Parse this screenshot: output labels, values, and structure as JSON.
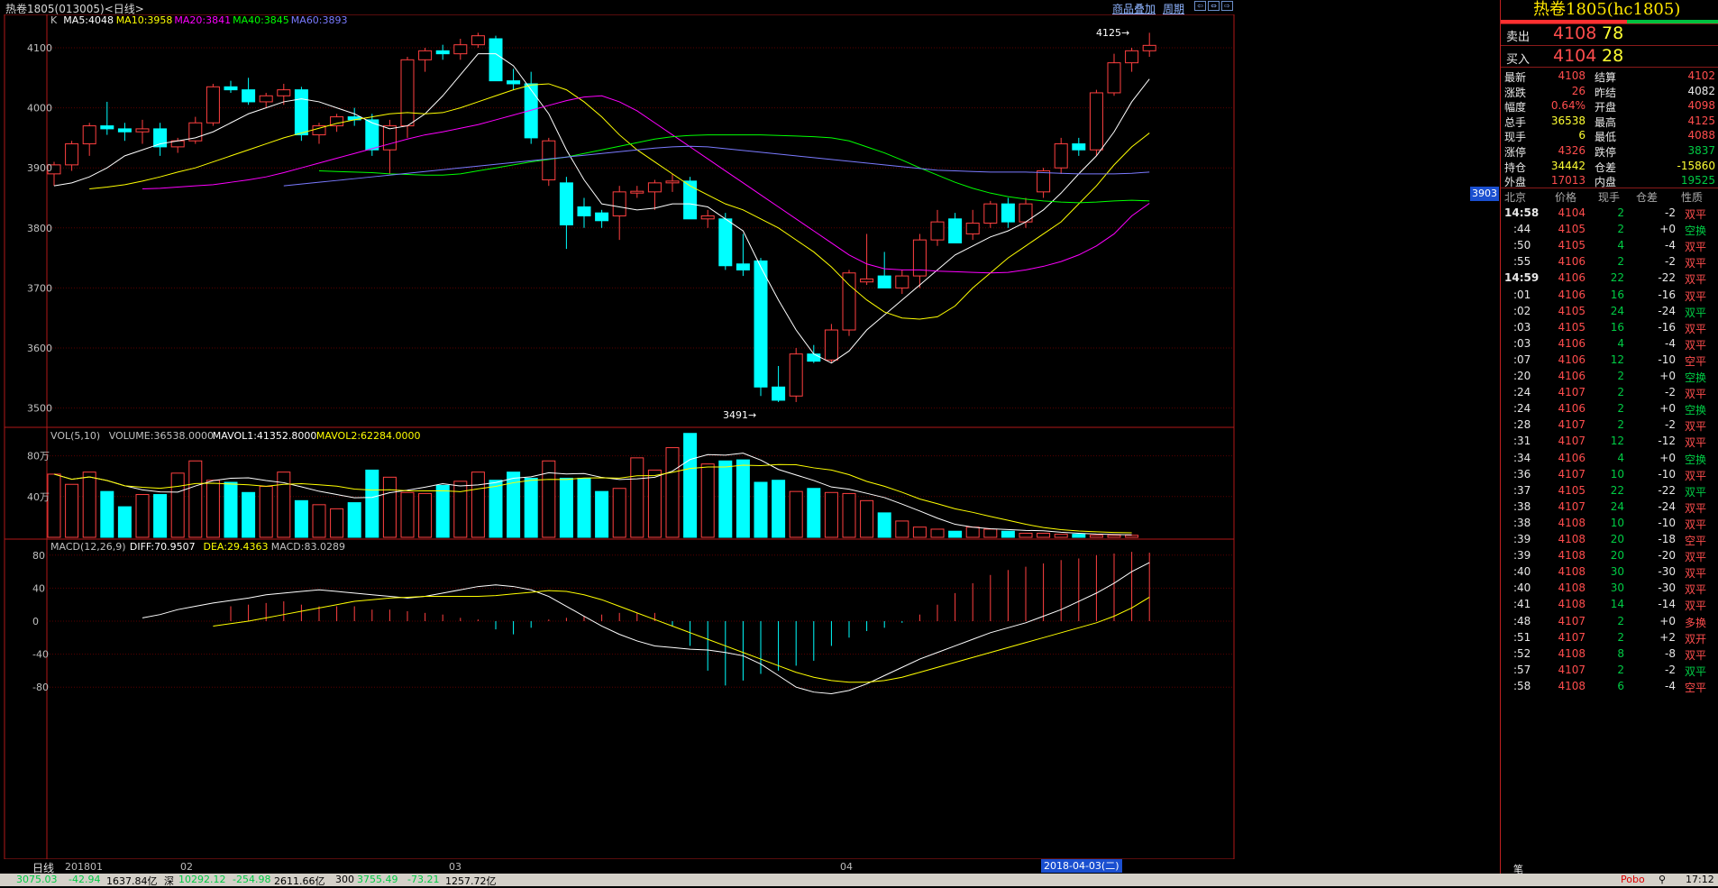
{
  "topbar": {
    "title": "热卷1805(013005)<日线>",
    "link_overlay": "商品叠加",
    "link_period": "周期"
  },
  "kpanel": {
    "label": "K",
    "ma5": "MA5:4048",
    "ma10": "MA10:3958",
    "ma20": "MA20:3841",
    "ma40": "MA40:3845",
    "ma60": "MA60:3893",
    "high_note": "4125",
    "low_note": "3491",
    "price_tag": "3903",
    "yticks": [
      "4100",
      "4000",
      "3900",
      "3800",
      "3700",
      "3600",
      "3500"
    ]
  },
  "vpanel": {
    "label": "VOL(5,10)",
    "volume": "VOLUME:36538.0000",
    "mavol1": "MAVOL1:41352.8000",
    "mavol2": "MAVOL2:62284.0000",
    "yticks": [
      "80万",
      "40万"
    ]
  },
  "mpanel": {
    "label": "MACD(12,26,9)",
    "diff": "DIFF:70.9507",
    "dea": "DEA:29.4363",
    "macd": "MACD:83.0289",
    "yticks": [
      "80",
      "40",
      "0",
      "-40",
      "-80"
    ]
  },
  "xaxis": {
    "tab": "日线",
    "labels": [
      "201801",
      "02",
      "03",
      "04"
    ],
    "selected_date": "2018-04-03(二)"
  },
  "colors": {
    "up": "#ff4040",
    "down": "#00ffff",
    "ma5": "#ffffff",
    "ma10": "#ffff00",
    "ma20": "#ff00ff",
    "ma40": "#00ff00",
    "ma60": "#7a7aff",
    "grid": "#5a0000"
  },
  "chart_data": {
    "type": "candlestick",
    "candles": [
      [
        3890,
        3910,
        3870,
        3905
      ],
      [
        3905,
        3945,
        3895,
        3940
      ],
      [
        3940,
        3975,
        3920,
        3970
      ],
      [
        3970,
        4010,
        3955,
        3965
      ],
      [
        3965,
        3975,
        3945,
        3960
      ],
      [
        3960,
        3980,
        3940,
        3965
      ],
      [
        3965,
        3975,
        3920,
        3935
      ],
      [
        3935,
        3950,
        3925,
        3945
      ],
      [
        3945,
        3985,
        3940,
        3975
      ],
      [
        3975,
        4040,
        3970,
        4035
      ],
      [
        4035,
        4045,
        4025,
        4030
      ],
      [
        4030,
        4050,
        4005,
        4010
      ],
      [
        4010,
        4025,
        4000,
        4020
      ],
      [
        4020,
        4040,
        4005,
        4030
      ],
      [
        4030,
        4035,
        3945,
        3955
      ],
      [
        3955,
        3975,
        3940,
        3970
      ],
      [
        3970,
        3990,
        3960,
        3985
      ],
      [
        3985,
        4000,
        3970,
        3980
      ],
      [
        3980,
        3990,
        3920,
        3930
      ],
      [
        3930,
        3980,
        3890,
        3970
      ],
      [
        3970,
        4085,
        3950,
        4080
      ],
      [
        4080,
        4100,
        4060,
        4095
      ],
      [
        4095,
        4105,
        4080,
        4090
      ],
      [
        4090,
        4115,
        4080,
        4105
      ],
      [
        4105,
        4125,
        4100,
        4120
      ],
      [
        4115,
        4120,
        4045,
        4045
      ],
      [
        4045,
        4065,
        4030,
        4040
      ],
      [
        4040,
        4060,
        3940,
        3950
      ],
      [
        3880,
        3950,
        3870,
        3945
      ],
      [
        3875,
        3885,
        3765,
        3805
      ],
      [
        3835,
        3850,
        3800,
        3820
      ],
      [
        3825,
        3830,
        3800,
        3812
      ],
      [
        3820,
        3870,
        3780,
        3860
      ],
      [
        3858,
        3870,
        3850,
        3861
      ],
      [
        3860,
        3880,
        3830,
        3875
      ],
      [
        3875,
        3890,
        3860,
        3878
      ],
      [
        3878,
        3885,
        3815,
        3815
      ],
      [
        3815,
        3830,
        3800,
        3820
      ],
      [
        3815,
        3825,
        3730,
        3737
      ],
      [
        3740,
        3790,
        3720,
        3730
      ],
      [
        3745,
        3750,
        3520,
        3535
      ],
      [
        3535,
        3570,
        3510,
        3513
      ],
      [
        3520,
        3600,
        3510,
        3590
      ],
      [
        3590,
        3605,
        3575,
        3578
      ],
      [
        3580,
        3640,
        3575,
        3630
      ],
      [
        3630,
        3730,
        3620,
        3725
      ],
      [
        3710,
        3790,
        3705,
        3715
      ],
      [
        3720,
        3760,
        3700,
        3700
      ],
      [
        3700,
        3730,
        3690,
        3720
      ],
      [
        3720,
        3790,
        3700,
        3780
      ],
      [
        3780,
        3830,
        3770,
        3810
      ],
      [
        3815,
        3825,
        3775,
        3775
      ],
      [
        3790,
        3830,
        3780,
        3808
      ],
      [
        3808,
        3845,
        3800,
        3840
      ],
      [
        3840,
        3850,
        3800,
        3810
      ],
      [
        3810,
        3850,
        3800,
        3840
      ],
      [
        3860,
        3900,
        3850,
        3895
      ],
      [
        3900,
        3950,
        3890,
        3940
      ],
      [
        3940,
        3950,
        3920,
        3930
      ],
      [
        3930,
        4030,
        3920,
        4025
      ],
      [
        4025,
        4090,
        4020,
        4075
      ],
      [
        4075,
        4100,
        4060,
        4095
      ],
      [
        4095,
        4125,
        4085,
        4104
      ]
    ],
    "ma5": [
      3870,
      3875,
      3885,
      3900,
      3920,
      3930,
      3940,
      3945,
      3950,
      3960,
      3975,
      3990,
      4000,
      4010,
      4015,
      4010,
      4000,
      3990,
      3975,
      3965,
      3970,
      3990,
      4020,
      4055,
      4090,
      4090,
      4070,
      4030,
      3990,
      3930,
      3880,
      3840,
      3835,
      3830,
      3833,
      3840,
      3840,
      3835,
      3815,
      3795,
      3735,
      3680,
      3630,
      3590,
      3575,
      3595,
      3630,
      3655,
      3680,
      3705,
      3730,
      3755,
      3770,
      3785,
      3795,
      3810,
      3830,
      3858,
      3890,
      3920,
      3960,
      4010,
      4048
    ],
    "ma10": [
      3865,
      3868,
      3872,
      3878,
      3885,
      3893,
      3900,
      3910,
      3920,
      3930,
      3940,
      3950,
      3958,
      3966,
      3974,
      3980,
      3985,
      3990,
      3992,
      3990,
      3992,
      4000,
      4010,
      4020,
      4030,
      4038,
      4040,
      4030,
      4010,
      3985,
      3955,
      3930,
      3910,
      3890,
      3870,
      3855,
      3840,
      3830,
      3815,
      3800,
      3780,
      3760,
      3735,
      3705,
      3680,
      3660,
      3650,
      3648,
      3652,
      3670,
      3700,
      3725,
      3750,
      3770,
      3790,
      3810,
      3840,
      3870,
      3905,
      3935,
      3958
    ],
    "ma20": [
      3865,
      3866,
      3868,
      3870,
      3872,
      3876,
      3880,
      3885,
      3892,
      3900,
      3908,
      3916,
      3924,
      3932,
      3940,
      3948,
      3955,
      3960,
      3966,
      3972,
      3980,
      3988,
      3996,
      4004,
      4012,
      4018,
      4020,
      4010,
      3995,
      3975,
      3955,
      3935,
      3915,
      3895,
      3875,
      3855,
      3835,
      3815,
      3795,
      3775,
      3755,
      3740,
      3732,
      3730,
      3730,
      3728,
      3727,
      3726,
      3725,
      3726,
      3730,
      3736,
      3744,
      3755,
      3770,
      3790,
      3820,
      3841
    ],
    "ma40": [
      3895,
      3894,
      3893,
      3892,
      3890,
      3889,
      3888,
      3888,
      3890,
      3895,
      3900,
      3905,
      3910,
      3914,
      3918,
      3924,
      3930,
      3936,
      3942,
      3948,
      3952,
      3954,
      3955,
      3955,
      3955,
      3955,
      3954,
      3953,
      3952,
      3950,
      3945,
      3935,
      3925,
      3913,
      3900,
      3888,
      3876,
      3866,
      3858,
      3852,
      3848,
      3845,
      3843,
      3842,
      3843,
      3845,
      3846,
      3845
    ],
    "ma60": [
      3870,
      3873,
      3876,
      3879,
      3882,
      3885,
      3888,
      3891,
      3894,
      3897,
      3900,
      3903,
      3906,
      3909,
      3912,
      3915,
      3918,
      3921,
      3924,
      3927,
      3930,
      3933,
      3935,
      3936,
      3935,
      3932,
      3929,
      3926,
      3923,
      3920,
      3917,
      3914,
      3911,
      3908,
      3905,
      3902,
      3899,
      3896,
      3895,
      3894,
      3893,
      3893,
      3893,
      3892,
      3891,
      3890,
      3890,
      3890,
      3891,
      3893
    ],
    "volume": [
      620000,
      520000,
      640000,
      450000,
      300000,
      420000,
      420000,
      630000,
      750000,
      560000,
      540000,
      440000,
      500000,
      640000,
      360000,
      320000,
      280000,
      340000,
      660000,
      590000,
      440000,
      430000,
      510000,
      550000,
      640000,
      560000,
      640000,
      580000,
      750000,
      580000,
      580000,
      450000,
      480000,
      780000,
      660000,
      880000,
      1020000,
      720000,
      750000,
      760000,
      540000,
      560000,
      450000,
      480000,
      440000,
      430000,
      360000,
      240000,
      160000,
      100000,
      80000,
      60000,
      100000,
      80000,
      60000,
      40000,
      40000,
      30000,
      30000,
      20000,
      20000,
      20000
    ],
    "macd_diff": [
      4,
      8,
      14,
      18,
      22,
      25,
      28,
      32,
      34,
      36,
      38,
      36,
      34,
      32,
      30,
      28,
      30,
      34,
      38,
      42,
      44,
      42,
      38,
      30,
      18,
      6,
      -6,
      -16,
      -24,
      -30,
      -32,
      -34,
      -35,
      -38,
      -42,
      -52,
      -66,
      -80,
      -86,
      -88,
      -84,
      -76,
      -66,
      -56,
      -46,
      -38,
      -30,
      -22,
      -14,
      -8,
      -2,
      6,
      14,
      24,
      34,
      46,
      60,
      71
    ],
    "macd_dea": [
      -6,
      -3,
      0,
      4,
      8,
      12,
      16,
      20,
      24,
      26,
      28,
      29,
      30,
      30,
      30,
      30,
      31,
      33,
      35,
      37,
      36,
      32,
      26,
      18,
      10,
      2,
      -6,
      -14,
      -22,
      -30,
      -38,
      -46,
      -54,
      -62,
      -68,
      -72,
      -74,
      -74,
      -72,
      -68,
      -62,
      -56,
      -50,
      -44,
      -38,
      -32,
      -26,
      -20,
      -14,
      -8,
      -2,
      6,
      16,
      29
    ],
    "macd_hist": [
      18,
      20,
      22,
      24,
      20,
      18,
      18,
      18,
      14,
      14,
      12,
      10,
      8,
      4,
      2,
      -10,
      -16,
      -8,
      2,
      4,
      6,
      8,
      10,
      10,
      10,
      -6,
      -30,
      -60,
      -78,
      -72,
      -64,
      -60,
      -54,
      -48,
      -30,
      -20,
      -12,
      -8,
      -2,
      8,
      20,
      34,
      46,
      56,
      62,
      66,
      70,
      74,
      76,
      80,
      82,
      84,
      83
    ]
  },
  "panel": {
    "title": "热卷1805(hc1805)",
    "sell_label": "卖出",
    "sell_price": "4108",
    "sell_qty": "78",
    "buy_label": "买入",
    "buy_price": "4104",
    "buy_qty": "28",
    "quotes": [
      {
        "l": "最新",
        "v": "4108",
        "vc": "up",
        "l2": "结算",
        "v2": "4102",
        "v2c": "up"
      },
      {
        "l": "涨跌",
        "v": "26",
        "vc": "up",
        "l2": "昨结",
        "v2": "4082",
        "v2c": "wh"
      },
      {
        "l": "幅度",
        "v": "0.64%",
        "vc": "up",
        "l2": "开盘",
        "v2": "4098",
        "v2c": "up"
      },
      {
        "l": "总手",
        "v": "36538",
        "vc": "ye",
        "l2": "最高",
        "v2": "4125",
        "v2c": "up"
      },
      {
        "l": "现手",
        "v": "6",
        "vc": "ye",
        "l2": "最低",
        "v2": "4088",
        "v2c": "up"
      },
      {
        "l": "涨停",
        "v": "4326",
        "vc": "up",
        "l2": "跌停",
        "v2": "3837",
        "v2c": "dn"
      },
      {
        "l": "持仓",
        "v": "34442",
        "vc": "ye",
        "l2": "仓差",
        "v2": "-15860",
        "v2c": "ye"
      },
      {
        "l": "外盘",
        "v": "17013",
        "vc": "up",
        "l2": "内盘",
        "v2": "19525",
        "v2c": "dn"
      }
    ],
    "thead": [
      "北京",
      "价格",
      "现手",
      "仓差",
      "性质"
    ],
    "trades": [
      {
        "t": "14:58",
        "p": "4104",
        "q": "2",
        "d": "-2",
        "n": "双平",
        "nc": "up"
      },
      {
        "t": ":44",
        "p": "4105",
        "q": "2",
        "d": "+0",
        "n": "空换",
        "nc": "dn"
      },
      {
        "t": ":50",
        "p": "4105",
        "q": "4",
        "d": "-4",
        "n": "双平",
        "nc": "up"
      },
      {
        "t": ":55",
        "p": "4106",
        "q": "2",
        "d": "-2",
        "n": "双平",
        "nc": "up"
      },
      {
        "t": "14:59",
        "p": "4106",
        "q": "22",
        "d": "-22",
        "n": "双平",
        "nc": "up"
      },
      {
        "t": ":01",
        "p": "4106",
        "q": "16",
        "d": "-16",
        "n": "双平",
        "nc": "up"
      },
      {
        "t": ":02",
        "p": "4105",
        "q": "24",
        "d": "-24",
        "n": "双平",
        "nc": "dn"
      },
      {
        "t": ":03",
        "p": "4105",
        "q": "16",
        "d": "-16",
        "n": "双平",
        "nc": "up"
      },
      {
        "t": ":03",
        "p": "4106",
        "q": "4",
        "d": "-4",
        "n": "双平",
        "nc": "up"
      },
      {
        "t": ":07",
        "p": "4106",
        "q": "12",
        "d": "-10",
        "n": "空平",
        "nc": "up"
      },
      {
        "t": ":20",
        "p": "4106",
        "q": "2",
        "d": "+0",
        "n": "空换",
        "nc": "dn"
      },
      {
        "t": ":24",
        "p": "4107",
        "q": "2",
        "d": "-2",
        "n": "双平",
        "nc": "up"
      },
      {
        "t": ":24",
        "p": "4106",
        "q": "2",
        "d": "+0",
        "n": "空换",
        "nc": "dn"
      },
      {
        "t": ":28",
        "p": "4107",
        "q": "2",
        "d": "-2",
        "n": "双平",
        "nc": "up"
      },
      {
        "t": ":31",
        "p": "4107",
        "q": "12",
        "d": "-12",
        "n": "双平",
        "nc": "up"
      },
      {
        "t": ":34",
        "p": "4106",
        "q": "4",
        "d": "+0",
        "n": "空换",
        "nc": "dn"
      },
      {
        "t": ":36",
        "p": "4107",
        "q": "10",
        "d": "-10",
        "n": "双平",
        "nc": "up"
      },
      {
        "t": ":37",
        "p": "4105",
        "q": "22",
        "d": "-22",
        "n": "双平",
        "nc": "dn"
      },
      {
        "t": ":38",
        "p": "4107",
        "q": "24",
        "d": "-24",
        "n": "双平",
        "nc": "up"
      },
      {
        "t": ":38",
        "p": "4108",
        "q": "10",
        "d": "-10",
        "n": "双平",
        "nc": "up"
      },
      {
        "t": ":39",
        "p": "4108",
        "q": "20",
        "d": "-18",
        "n": "空平",
        "nc": "up"
      },
      {
        "t": ":39",
        "p": "4108",
        "q": "20",
        "d": "-20",
        "n": "双平",
        "nc": "up"
      },
      {
        "t": ":40",
        "p": "4108",
        "q": "30",
        "d": "-30",
        "n": "双平",
        "nc": "up"
      },
      {
        "t": ":40",
        "p": "4108",
        "q": "30",
        "d": "-30",
        "n": "双平",
        "nc": "up"
      },
      {
        "t": ":41",
        "p": "4108",
        "q": "14",
        "d": "-14",
        "n": "双平",
        "nc": "up"
      },
      {
        "t": ":48",
        "p": "4107",
        "q": "2",
        "d": "+0",
        "n": "多换",
        "nc": "up"
      },
      {
        "t": ":51",
        "p": "4107",
        "q": "2",
        "d": "+2",
        "n": "双开",
        "nc": "up"
      },
      {
        "t": ":52",
        "p": "4108",
        "q": "8",
        "d": "-8",
        "n": "双平",
        "nc": "up"
      },
      {
        "t": ":57",
        "p": "4107",
        "q": "2",
        "d": "-2",
        "n": "双平",
        "nc": "dn"
      },
      {
        "t": ":58",
        "p": "4108",
        "q": "6",
        "d": "-4",
        "n": "空平",
        "nc": "up"
      }
    ],
    "foot": "笔"
  },
  "status": {
    "s1": "3075.03",
    "s1d": "-42.94",
    "s1v": "1637.84亿",
    "s2l": "深",
    "s2": "10292.12",
    "s2d": "-254.98",
    "s2v": "2611.66亿",
    "s3l": "300",
    "s3": "3755.49",
    "s3d": "-73.21",
    "s3v": "1257.72亿",
    "brand": "Pobo",
    "time": "17:12"
  }
}
